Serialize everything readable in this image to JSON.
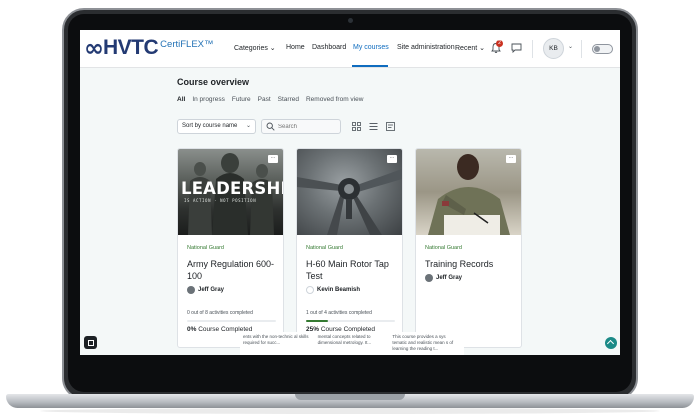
{
  "brand": {
    "wordmark": "HVTC",
    "sub": "CertiFLEX™"
  },
  "nav": {
    "categories": "Categories ⌄",
    "home": "Home",
    "dashboard": "Dashboard",
    "my_courses": "My courses",
    "site_admin": "Site administration",
    "recent": "Recent ⌄",
    "notification_count": "2",
    "user_initials": "KB",
    "user_caret": "⌄"
  },
  "page": {
    "title": "Course overview",
    "filters": [
      "All",
      "In progress",
      "Future",
      "Past",
      "Starred",
      "Removed from view"
    ],
    "sort_label": "Sort by course name",
    "sort_caret": "⌄",
    "search_placeholder": "Search"
  },
  "courses": [
    {
      "image_title": "LEADERSHIP",
      "image_tagline": "IS ACTION · NOT POSITION",
      "category": "National Guard",
      "title": "Army Regulation 600-100",
      "teacher": "Jeff Gray",
      "activity": "0 out of 8 activities completed",
      "progress_percent": 0,
      "percent_label": "0%",
      "complete_label": " Course Completed"
    },
    {
      "category": "National Guard",
      "title": "H-60 Main Rotor Tap Test",
      "teacher": "Kevin Beamish",
      "activity": "1 out of 4 activities completed",
      "progress_percent": 25,
      "percent_label": "25%",
      "complete_label": " Course Completed"
    },
    {
      "category": "National Guard",
      "title": "Training Records",
      "teacher": "Jeff Gray"
    }
  ],
  "strip": [
    "ents with the non-technic al skills required for succ...",
    "mental concepts related to dimensional metrology. It...",
    "This course provides a sys tematic and realistic mean s of learning the reading t..."
  ],
  "colors": {
    "brand_navy": "#233a73",
    "link_blue": "#0f6cbf",
    "category_green": "#357a32",
    "fab_teal": "#1b8a87"
  }
}
